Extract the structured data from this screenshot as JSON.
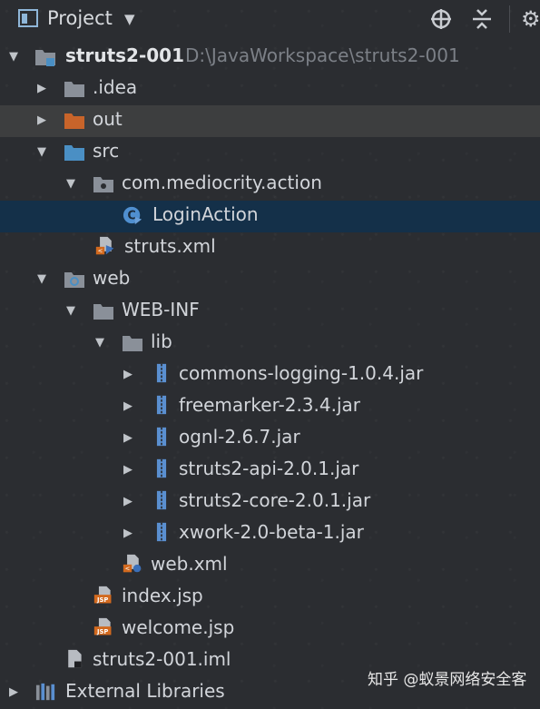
{
  "header": {
    "title": "Project"
  },
  "tree": [
    {
      "label": "struts2-001",
      "path": "D:\\JavaWorkspace\\struts2-001",
      "icon": "module-folder-icon",
      "arrow": "down"
    },
    {
      "label": ".idea",
      "icon": "folder-icon",
      "arrow": "right"
    },
    {
      "label": "out",
      "icon": "excluded-folder-icon",
      "arrow": "right"
    },
    {
      "label": "src",
      "icon": "source-folder-icon",
      "arrow": "down"
    },
    {
      "label": "com.mediocrity.action",
      "icon": "package-icon",
      "arrow": "down"
    },
    {
      "label": "LoginAction",
      "icon": "struts-action-class-icon",
      "arrow": ""
    },
    {
      "label": "struts.xml",
      "icon": "struts-xml-icon",
      "arrow": ""
    },
    {
      "label": "web",
      "icon": "web-folder-icon",
      "arrow": "down"
    },
    {
      "label": "WEB-INF",
      "icon": "folder-icon",
      "arrow": "down"
    },
    {
      "label": "lib",
      "icon": "folder-icon",
      "arrow": "down"
    },
    {
      "label": "commons-logging-1.0.4.jar",
      "icon": "jar-icon",
      "arrow": "right"
    },
    {
      "label": "freemarker-2.3.4.jar",
      "icon": "jar-icon",
      "arrow": "right"
    },
    {
      "label": "ognl-2.6.7.jar",
      "icon": "jar-icon",
      "arrow": "right"
    },
    {
      "label": "struts2-api-2.0.1.jar",
      "icon": "jar-icon",
      "arrow": "right"
    },
    {
      "label": "struts2-core-2.0.1.jar",
      "icon": "jar-icon",
      "arrow": "right"
    },
    {
      "label": "xwork-2.0-beta-1.jar",
      "icon": "jar-icon",
      "arrow": "right"
    },
    {
      "label": "web.xml",
      "icon": "web-xml-icon",
      "arrow": ""
    },
    {
      "label": "index.jsp",
      "icon": "jsp-icon",
      "arrow": ""
    },
    {
      "label": "welcome.jsp",
      "icon": "jsp-icon",
      "arrow": ""
    },
    {
      "label": "struts2-001.iml",
      "icon": "iml-file-icon",
      "arrow": ""
    },
    {
      "label": "External Libraries",
      "icon": "libraries-icon",
      "arrow": "right"
    }
  ],
  "watermark": "知乎 @蚁景网络安全客",
  "colors": {
    "background": "#2b2d31",
    "selection": "#143049",
    "out_highlight": "#3d3e3f",
    "folder": "#8a9099",
    "source_folder": "#4a8fc4",
    "excluded_folder": "#c8642a",
    "jar_blue": "#5a8fd0",
    "jsp_orange": "#d2691e"
  }
}
